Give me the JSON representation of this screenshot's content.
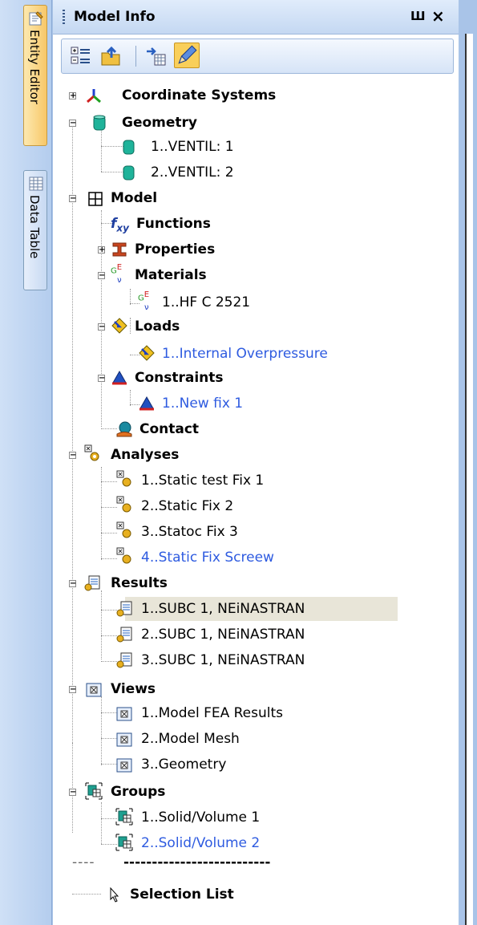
{
  "side_tabs": [
    "Entity Editor",
    "Data Table"
  ],
  "panel": {
    "title": "Model Info",
    "pin_glyph": "Ш",
    "close_glyph": "×"
  },
  "toolbar": {
    "icons": [
      "expand-collapse-icon",
      "open-folder-icon",
      "add-item-icon",
      "edit-pencil-icon"
    ]
  },
  "tree": {
    "coordinate_systems": "Coordinate Systems",
    "geometry": {
      "label": "Geometry",
      "items": [
        "1..VENTIL: 1",
        "2..VENTIL: 2"
      ]
    },
    "model": {
      "label": "Model",
      "functions": "Functions",
      "properties": "Properties",
      "materials": {
        "label": "Materials",
        "items": [
          "1..HF C 2521"
        ]
      },
      "loads": {
        "label": "Loads",
        "items": [
          "1..Internal Overpressure"
        ]
      },
      "constraints": {
        "label": "Constraints",
        "items": [
          "1..New fix 1"
        ]
      },
      "contact": "Contact"
    },
    "analyses": {
      "label": "Analyses",
      "items": [
        "1..Static test Fix 1",
        "2..Static Fix 2",
        "3..Statoc Fix 3",
        "4..Static Fix Screew"
      ]
    },
    "results": {
      "label": "Results",
      "items": [
        "1..SUBC 1, NEiNASTRAN",
        "2..SUBC 1, NEiNASTRAN",
        "3..SUBC 1, NEiNASTRAN"
      ]
    },
    "views": {
      "label": "Views",
      "items": [
        "1..Model FEA Results",
        "2..Model Mesh",
        "3..Geometry"
      ]
    },
    "groups": {
      "label": "Groups",
      "items": [
        "1..Solid/Volume 1",
        "2..Solid/Volume 2"
      ]
    },
    "separator": "--------------------------",
    "selection_list": "Selection List"
  },
  "colors": {
    "highlight_text": "#2e5be0",
    "selected_row": "#e8e5d8",
    "active_tab": "#f7c768"
  }
}
